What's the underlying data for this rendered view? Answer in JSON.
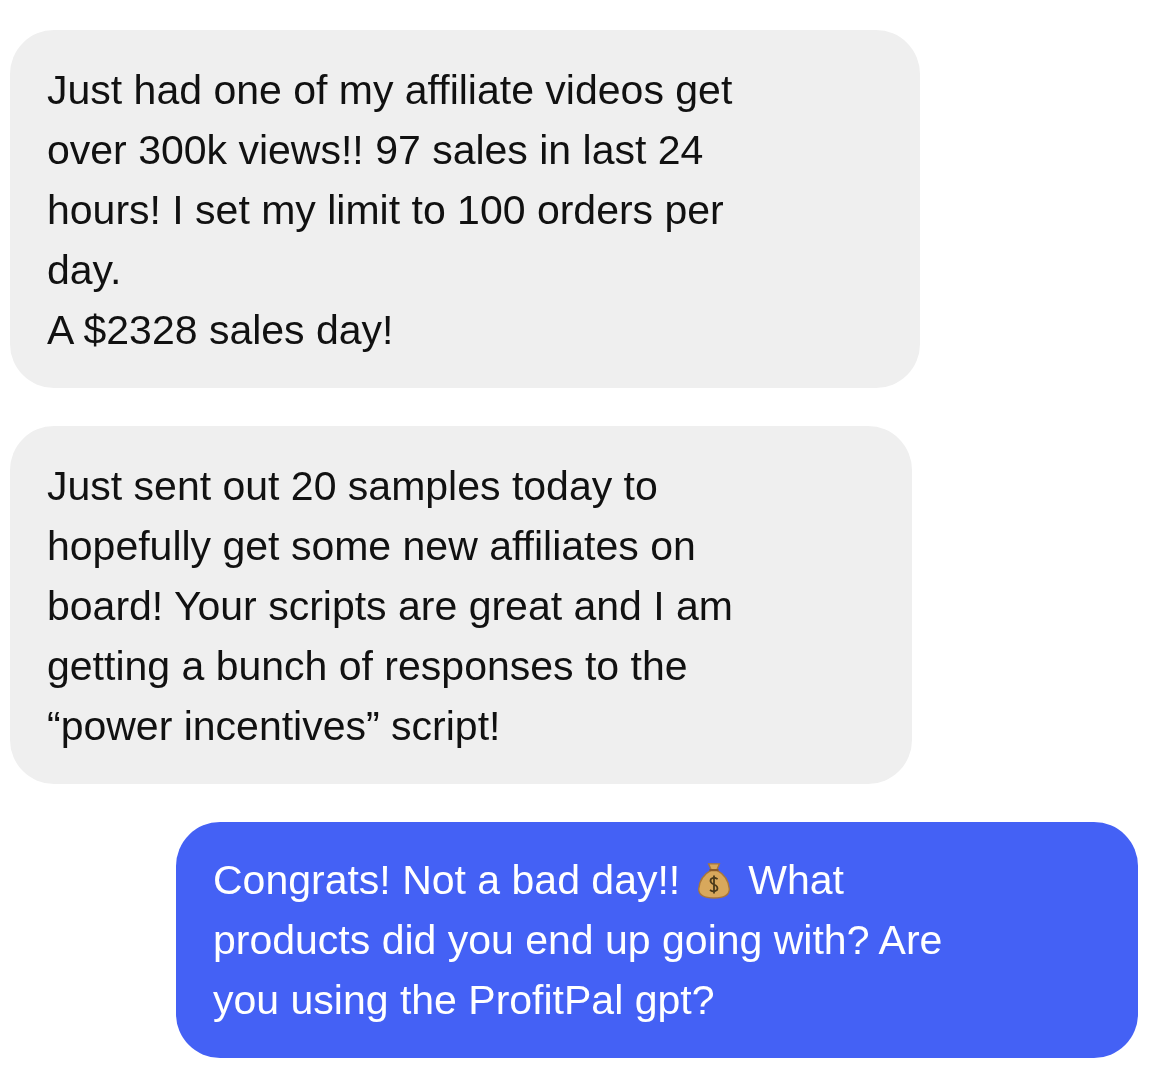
{
  "messages": [
    {
      "kind": "incoming",
      "lines": [
        [
          {
            "kind": "text",
            "text": "Just had one of my affiliate videos get"
          }
        ],
        [
          {
            "kind": "text",
            "text": "over 300k views!! 97 sales in last 24"
          }
        ],
        [
          {
            "kind": "text",
            "text": "hours! I set my limit to 100 orders per"
          }
        ],
        [
          {
            "kind": "text",
            "text": "day."
          }
        ],
        [
          {
            "kind": "text",
            "text": "A $2328 sales day!"
          }
        ]
      ]
    },
    {
      "kind": "incoming",
      "lines": [
        [
          {
            "kind": "text",
            "text": "Just sent out 20 samples today to"
          }
        ],
        [
          {
            "kind": "text",
            "text": "hopefully get some new affiliates on"
          }
        ],
        [
          {
            "kind": "text",
            "text": "board! Your scripts are great and I am"
          }
        ],
        [
          {
            "kind": "text",
            "text": "getting a bunch of responses to the"
          }
        ],
        [
          {
            "kind": "text",
            "text": "“power incentives” script!"
          }
        ]
      ]
    },
    {
      "kind": "outgoing",
      "lines": [
        [
          {
            "kind": "text",
            "text": "Congrats! Not a bad day!!"
          },
          {
            "kind": "icon"
          },
          {
            "kind": "text",
            "text": "What"
          }
        ],
        [
          {
            "kind": "text",
            "text": "products did you end up going with? Are"
          }
        ],
        [
          {
            "kind": "text",
            "text": "you using the ProfitPal gpt?"
          }
        ]
      ]
    }
  ]
}
